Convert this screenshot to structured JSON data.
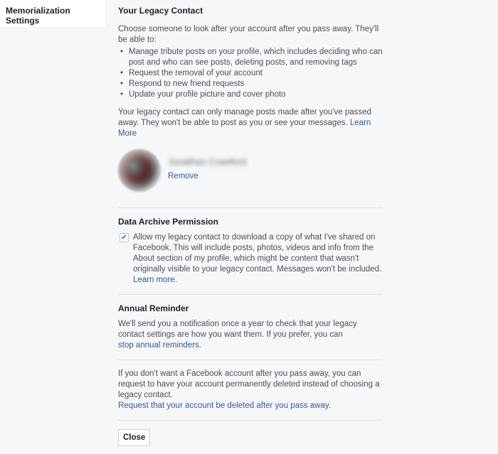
{
  "sidebar": {
    "title": "Memorialization Settings"
  },
  "legacy": {
    "heading": "Your Legacy Contact",
    "intro": "Choose someone to look after your account after you pass away. They'll be able to:",
    "items": [
      "Manage tribute posts on your profile, which includes deciding who can post and who can see posts, deleting posts, and removing tags",
      "Request the removal of your account",
      "Respond to new friend requests",
      "Update your profile picture and cover photo"
    ],
    "note": "Your legacy contact can only manage posts made after you've passed away. They won't be able to post as you or see your messages.",
    "learn_more": "Learn More",
    "contact": {
      "name": "Jonathan Crawford",
      "remove_label": "Remove"
    }
  },
  "archive": {
    "heading": "Data Archive Permission",
    "checked": true,
    "text": "Allow my legacy contact to download a copy of what I've shared on Facebook. This will include posts, photos, videos and info from the About section of my profile, which might be content that wasn't originally visible to your legacy contact. Messages won't be included.",
    "learn_more": "Learn more",
    "period": "."
  },
  "reminder": {
    "heading": "Annual Reminder",
    "text": "We'll send you a notification once a year to check that your legacy contact settings are how you want them. If you prefer, you can",
    "link": "stop annual reminders",
    "period": "."
  },
  "delete": {
    "text": "If you don't want a Facebook account after you pass away, you can request to have your account permanently deleted instead of choosing a legacy contact.",
    "link": "Request that your account be deleted after you pass away",
    "period": "."
  },
  "footer": {
    "close_label": "Close"
  }
}
